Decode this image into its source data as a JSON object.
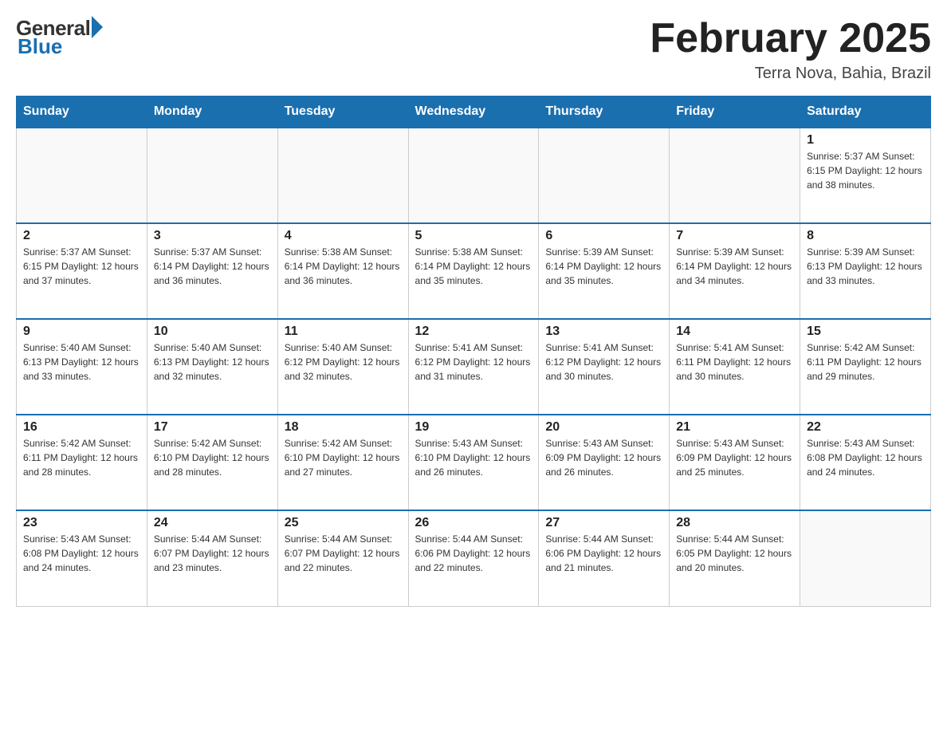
{
  "logo": {
    "general": "General",
    "blue": "Blue"
  },
  "title": "February 2025",
  "location": "Terra Nova, Bahia, Brazil",
  "days_of_week": [
    "Sunday",
    "Monday",
    "Tuesday",
    "Wednesday",
    "Thursday",
    "Friday",
    "Saturday"
  ],
  "weeks": [
    [
      {
        "day": "",
        "info": ""
      },
      {
        "day": "",
        "info": ""
      },
      {
        "day": "",
        "info": ""
      },
      {
        "day": "",
        "info": ""
      },
      {
        "day": "",
        "info": ""
      },
      {
        "day": "",
        "info": ""
      },
      {
        "day": "1",
        "info": "Sunrise: 5:37 AM\nSunset: 6:15 PM\nDaylight: 12 hours\nand 38 minutes."
      }
    ],
    [
      {
        "day": "2",
        "info": "Sunrise: 5:37 AM\nSunset: 6:15 PM\nDaylight: 12 hours\nand 37 minutes."
      },
      {
        "day": "3",
        "info": "Sunrise: 5:37 AM\nSunset: 6:14 PM\nDaylight: 12 hours\nand 36 minutes."
      },
      {
        "day": "4",
        "info": "Sunrise: 5:38 AM\nSunset: 6:14 PM\nDaylight: 12 hours\nand 36 minutes."
      },
      {
        "day": "5",
        "info": "Sunrise: 5:38 AM\nSunset: 6:14 PM\nDaylight: 12 hours\nand 35 minutes."
      },
      {
        "day": "6",
        "info": "Sunrise: 5:39 AM\nSunset: 6:14 PM\nDaylight: 12 hours\nand 35 minutes."
      },
      {
        "day": "7",
        "info": "Sunrise: 5:39 AM\nSunset: 6:14 PM\nDaylight: 12 hours\nand 34 minutes."
      },
      {
        "day": "8",
        "info": "Sunrise: 5:39 AM\nSunset: 6:13 PM\nDaylight: 12 hours\nand 33 minutes."
      }
    ],
    [
      {
        "day": "9",
        "info": "Sunrise: 5:40 AM\nSunset: 6:13 PM\nDaylight: 12 hours\nand 33 minutes."
      },
      {
        "day": "10",
        "info": "Sunrise: 5:40 AM\nSunset: 6:13 PM\nDaylight: 12 hours\nand 32 minutes."
      },
      {
        "day": "11",
        "info": "Sunrise: 5:40 AM\nSunset: 6:12 PM\nDaylight: 12 hours\nand 32 minutes."
      },
      {
        "day": "12",
        "info": "Sunrise: 5:41 AM\nSunset: 6:12 PM\nDaylight: 12 hours\nand 31 minutes."
      },
      {
        "day": "13",
        "info": "Sunrise: 5:41 AM\nSunset: 6:12 PM\nDaylight: 12 hours\nand 30 minutes."
      },
      {
        "day": "14",
        "info": "Sunrise: 5:41 AM\nSunset: 6:11 PM\nDaylight: 12 hours\nand 30 minutes."
      },
      {
        "day": "15",
        "info": "Sunrise: 5:42 AM\nSunset: 6:11 PM\nDaylight: 12 hours\nand 29 minutes."
      }
    ],
    [
      {
        "day": "16",
        "info": "Sunrise: 5:42 AM\nSunset: 6:11 PM\nDaylight: 12 hours\nand 28 minutes."
      },
      {
        "day": "17",
        "info": "Sunrise: 5:42 AM\nSunset: 6:10 PM\nDaylight: 12 hours\nand 28 minutes."
      },
      {
        "day": "18",
        "info": "Sunrise: 5:42 AM\nSunset: 6:10 PM\nDaylight: 12 hours\nand 27 minutes."
      },
      {
        "day": "19",
        "info": "Sunrise: 5:43 AM\nSunset: 6:10 PM\nDaylight: 12 hours\nand 26 minutes."
      },
      {
        "day": "20",
        "info": "Sunrise: 5:43 AM\nSunset: 6:09 PM\nDaylight: 12 hours\nand 26 minutes."
      },
      {
        "day": "21",
        "info": "Sunrise: 5:43 AM\nSunset: 6:09 PM\nDaylight: 12 hours\nand 25 minutes."
      },
      {
        "day": "22",
        "info": "Sunrise: 5:43 AM\nSunset: 6:08 PM\nDaylight: 12 hours\nand 24 minutes."
      }
    ],
    [
      {
        "day": "23",
        "info": "Sunrise: 5:43 AM\nSunset: 6:08 PM\nDaylight: 12 hours\nand 24 minutes."
      },
      {
        "day": "24",
        "info": "Sunrise: 5:44 AM\nSunset: 6:07 PM\nDaylight: 12 hours\nand 23 minutes."
      },
      {
        "day": "25",
        "info": "Sunrise: 5:44 AM\nSunset: 6:07 PM\nDaylight: 12 hours\nand 22 minutes."
      },
      {
        "day": "26",
        "info": "Sunrise: 5:44 AM\nSunset: 6:06 PM\nDaylight: 12 hours\nand 22 minutes."
      },
      {
        "day": "27",
        "info": "Sunrise: 5:44 AM\nSunset: 6:06 PM\nDaylight: 12 hours\nand 21 minutes."
      },
      {
        "day": "28",
        "info": "Sunrise: 5:44 AM\nSunset: 6:05 PM\nDaylight: 12 hours\nand 20 minutes."
      },
      {
        "day": "",
        "info": ""
      }
    ]
  ]
}
